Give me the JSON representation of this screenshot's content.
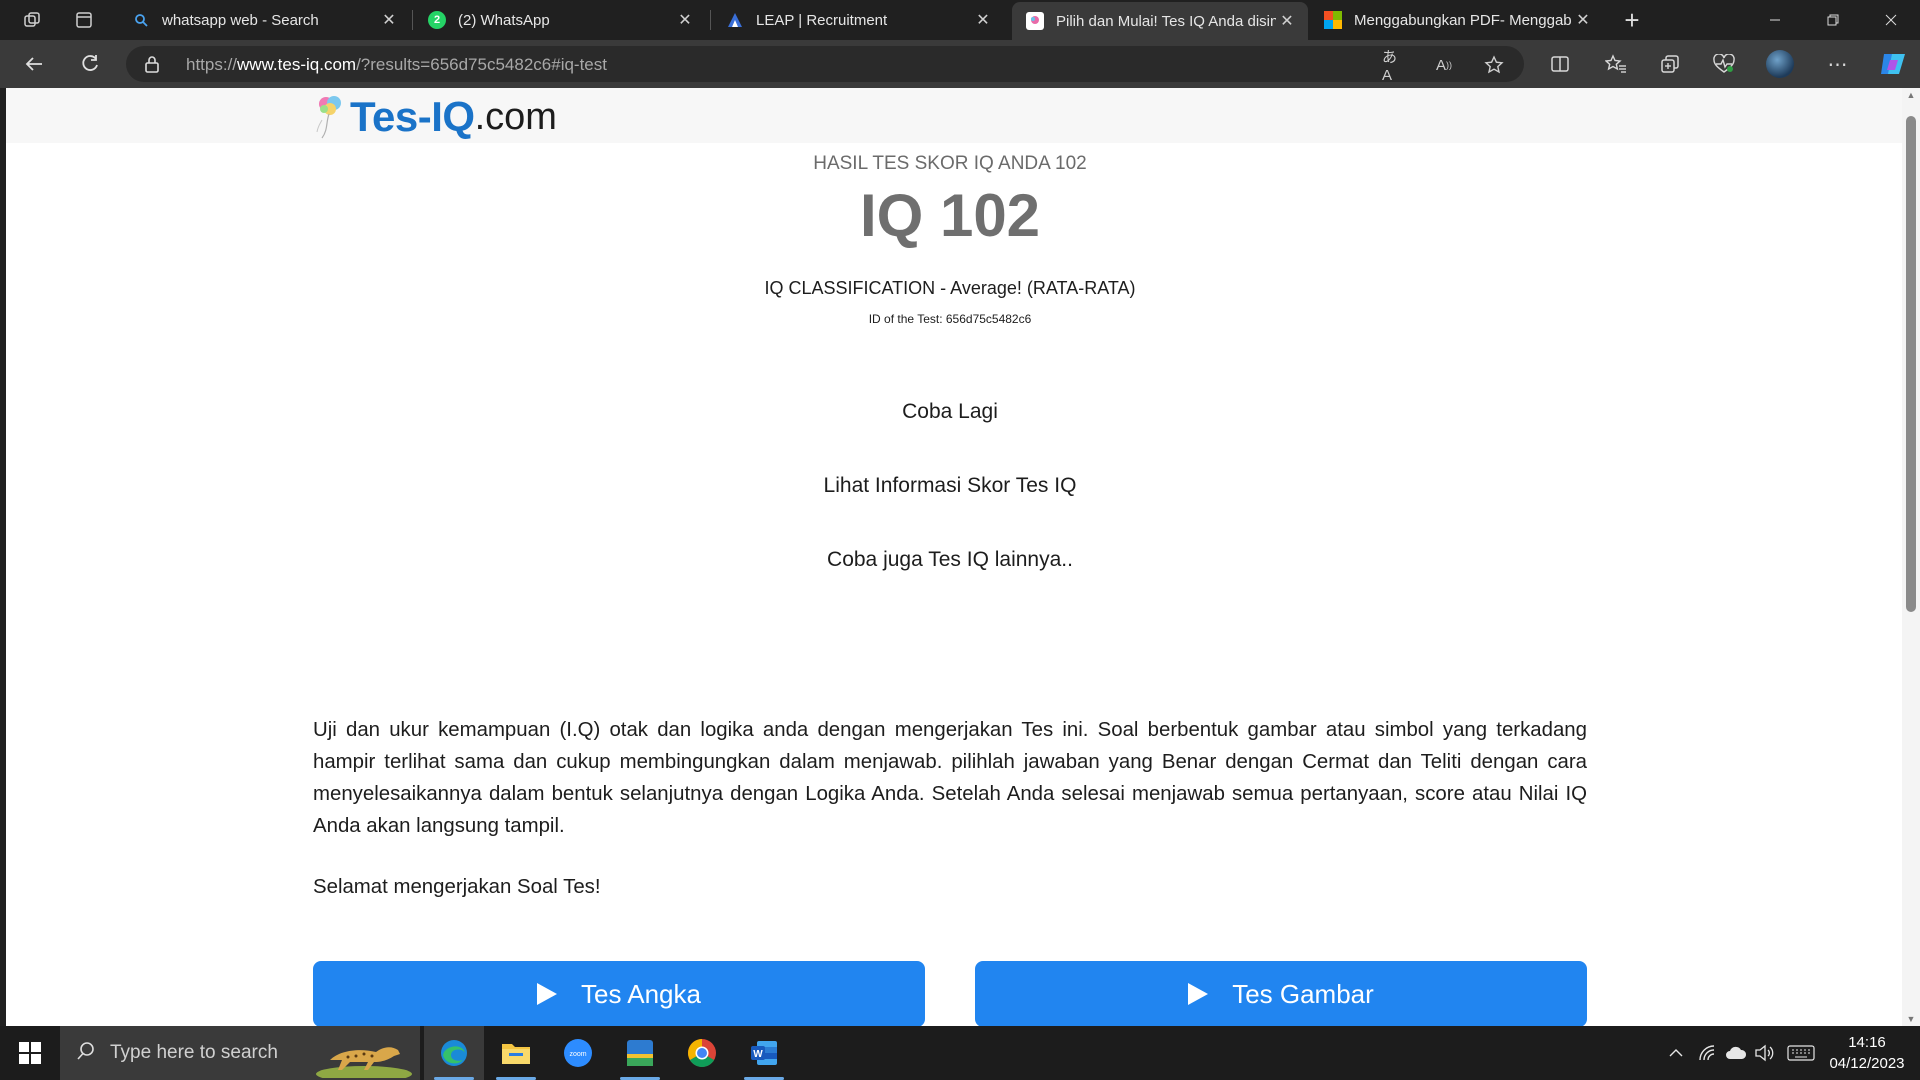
{
  "browser": {
    "tabs": [
      {
        "title": "whatsapp web - Search",
        "icon": "search-icon"
      },
      {
        "title": "(2) WhatsApp",
        "icon": "whatsapp-icon",
        "badge": "2"
      },
      {
        "title": "LEAP | Recruitment",
        "icon": "leap-icon"
      },
      {
        "title": "Pilih dan Mulai! Tes IQ Anda disin",
        "icon": "tes-iq-favicon",
        "active": true
      },
      {
        "title": "Menggabungkan PDF- Menggab",
        "icon": "pdf-merge-icon"
      }
    ],
    "url": {
      "prefix": "https://",
      "host": "www.tes-iq.com",
      "path": "/?results=656d75c5482c6#iq-test"
    }
  },
  "page": {
    "logo": {
      "brand": "Tes-IQ",
      "tld": ".com"
    },
    "result_title": "HASIL TES SKOR IQ ANDA 102",
    "iq_score": "IQ 102",
    "classification": "IQ CLASSIFICATION - Average! (RATA-RATA)",
    "test_id": "ID of the Test: 656d75c5482c6",
    "links": {
      "retry": "Coba Lagi",
      "score_info": "Lihat Informasi Skor Tes IQ",
      "other_tests": "Coba juga Tes IQ lainnya.."
    },
    "description": "Uji dan ukur kemampuan (I.Q) otak dan logika anda dengan mengerjakan Tes ini. Soal berbentuk gambar atau simbol yang terkadang hampir terlihat sama dan cukup membingungkan dalam menjawab. pilihlah jawaban yang Benar dengan Cermat dan Teliti dengan cara menyelesaikannya dalam bentuk selanjutnya dengan Logika Anda. Setelah Anda selesai menjawab semua pertanyaan, score atau Nilai IQ Anda akan langsung tampil.",
    "greeting": "Selamat mengerjakan Soal Tes!",
    "buttons": {
      "numbers": "Tes Angka",
      "pictures": "Tes Gambar"
    },
    "accent_color": "#2185f0"
  },
  "taskbar": {
    "search_placeholder": "Type here to search",
    "apps": [
      "edge-icon",
      "file-explorer-icon",
      "zoom-icon",
      "calendar-app-icon",
      "chrome-icon",
      "word-icon"
    ],
    "time": "14:16",
    "date": "04/12/2023"
  }
}
